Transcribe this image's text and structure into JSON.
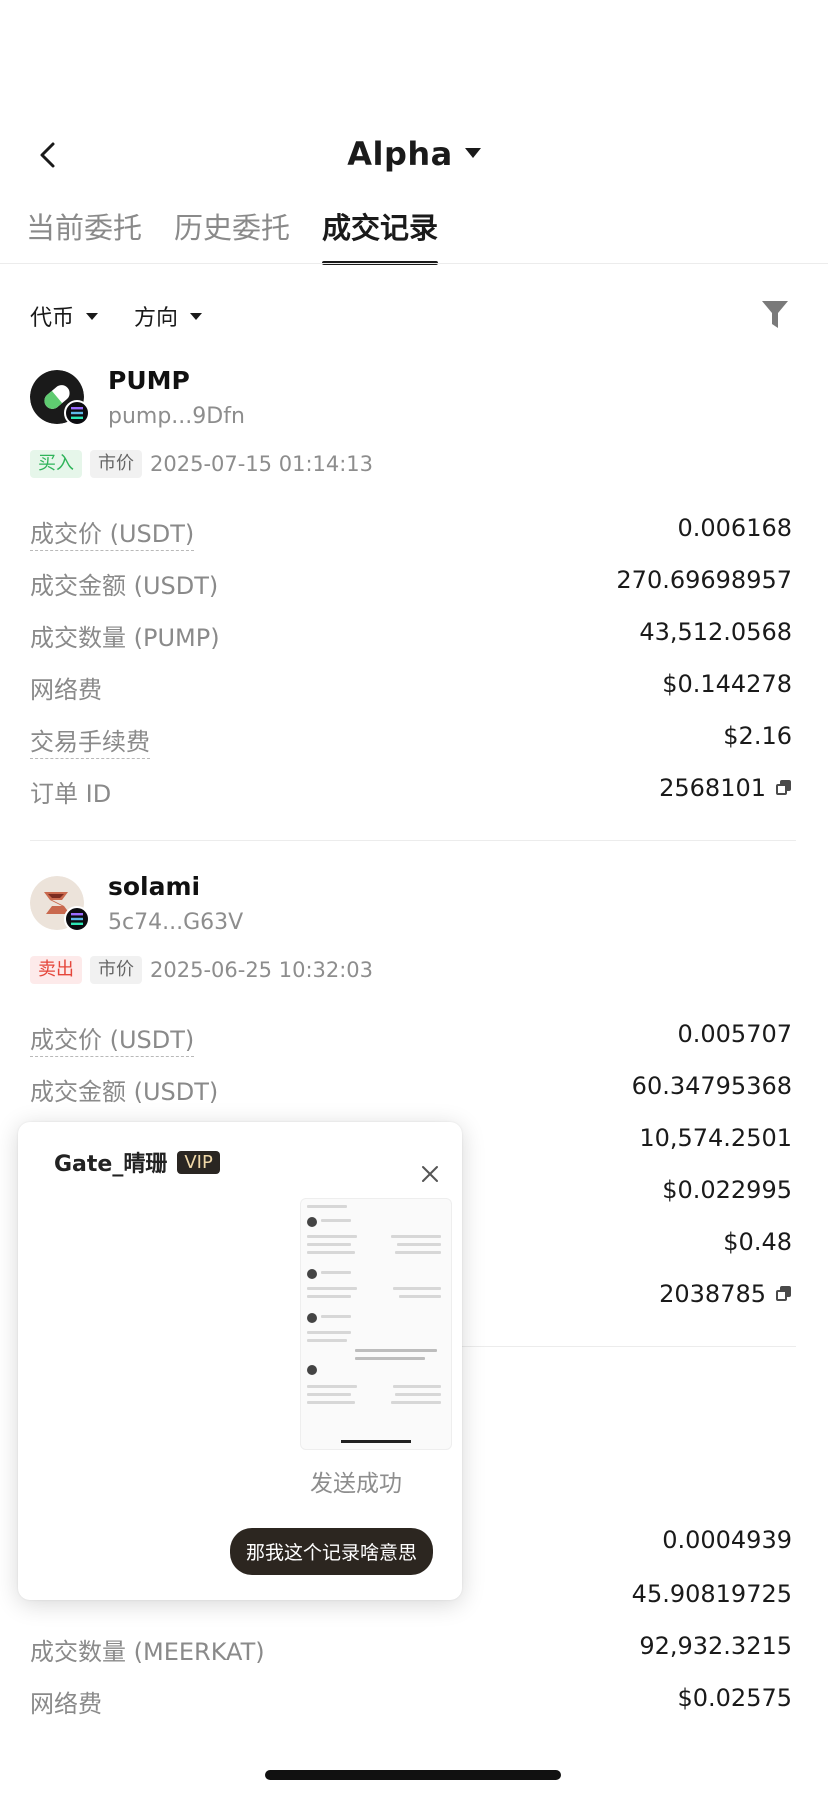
{
  "header": {
    "title": "Alpha"
  },
  "tabs": [
    {
      "label": "当前委托"
    },
    {
      "label": "历史委托"
    },
    {
      "label": "成交记录"
    }
  ],
  "filters": {
    "coin": "代币",
    "direction": "方向"
  },
  "trades": [
    {
      "name": "PUMP",
      "address": "pump...9Dfn",
      "side": "买入",
      "order_type": "市价",
      "datetime": "2025-07-15 01:14:13",
      "rows": [
        {
          "label": "成交价 (USDT)",
          "value": "0.006168"
        },
        {
          "label": "成交金额 (USDT)",
          "value": "270.69698957"
        },
        {
          "label": "成交数量 (PUMP)",
          "value": "43,512.0568"
        },
        {
          "label": "网络费",
          "value": "$0.144278"
        },
        {
          "label": "交易手续费",
          "value": "$2.16"
        },
        {
          "label": "订单 ID",
          "value": "2568101"
        }
      ]
    },
    {
      "name": "solami",
      "address": "5c74...G63V",
      "side": "卖出",
      "order_type": "市价",
      "datetime": "2025-06-25 10:32:03",
      "rows": [
        {
          "label": "成交价 (USDT)",
          "value": "0.005707"
        },
        {
          "label": "成交金额 (USDT)",
          "value": "60.34795368"
        },
        {
          "label": "",
          "value": "10,574.2501"
        },
        {
          "label": "",
          "value": "$0.022995"
        },
        {
          "label": "",
          "value": "$0.48"
        },
        {
          "label": "",
          "value": "2038785"
        }
      ]
    },
    {
      "rows": [
        {
          "label": "",
          "value": "0.0004939"
        },
        {
          "label": "",
          "value": "45.90819725"
        },
        {
          "label": "成交数量 (MEERKAT)",
          "value": "92,932.3215"
        },
        {
          "label": "网络费",
          "value": "$0.02575"
        }
      ]
    }
  ],
  "popup": {
    "sender": "Gate_晴珊",
    "badge": "VIP",
    "status": "发送成功",
    "message": "那我这个记录啥意思"
  },
  "colors": {
    "buy": "#2fb45a",
    "sell": "#e5463b",
    "text": "#1a1a1a",
    "muted": "#8a8a8a"
  }
}
